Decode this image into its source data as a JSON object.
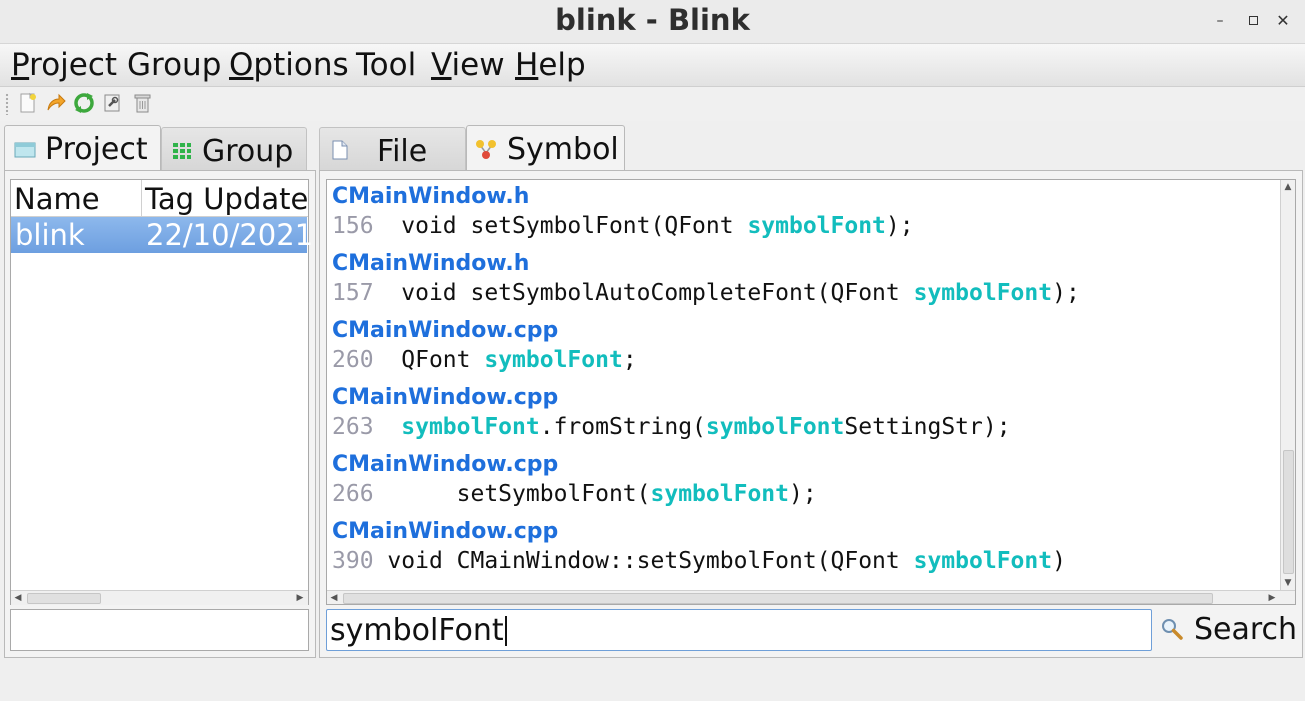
{
  "window": {
    "title": "blink - Blink"
  },
  "menu": [
    {
      "label": "Project",
      "underline": "P"
    },
    {
      "label": "Group",
      "underline": ""
    },
    {
      "label": "Options",
      "underline": "O"
    },
    {
      "label": "Tool",
      "underline": ""
    },
    {
      "label": "View",
      "underline": "V"
    },
    {
      "label": "Help",
      "underline": "H"
    }
  ],
  "toolbar": {
    "icons": [
      "new-project-icon",
      "open-icon",
      "refresh-icon",
      "settings-icon",
      "delete-icon"
    ]
  },
  "left_tabs": [
    {
      "label": "Project",
      "icon": "project-icon"
    },
    {
      "label": "Group",
      "icon": "group-icon"
    }
  ],
  "project_table": {
    "headers": [
      "Name",
      "Tag Update"
    ],
    "rows": [
      {
        "name": "blink",
        "tag_update": "22/10/2021"
      }
    ]
  },
  "right_tabs": [
    {
      "label": "File",
      "icon": "file-icon"
    },
    {
      "label": "Symbol",
      "icon": "symbol-icon"
    }
  ],
  "results": [
    {
      "file": "CMainWindow.h",
      "line": "156",
      "indent": "  ",
      "segments": [
        {
          "t": "void setSymbolFont(QFont ",
          "h": false
        },
        {
          "t": "symbolFont",
          "h": true
        },
        {
          "t": ");",
          "h": false
        }
      ]
    },
    {
      "file": "CMainWindow.h",
      "line": "157",
      "indent": "  ",
      "segments": [
        {
          "t": "void setSymbolAutoCompleteFont(QFont ",
          "h": false
        },
        {
          "t": "symbolFont",
          "h": true
        },
        {
          "t": ");",
          "h": false
        }
      ]
    },
    {
      "file": "CMainWindow.cpp",
      "line": "260",
      "indent": "  ",
      "segments": [
        {
          "t": "QFont ",
          "h": false
        },
        {
          "t": "symbolFont",
          "h": true
        },
        {
          "t": ";",
          "h": false
        }
      ]
    },
    {
      "file": "CMainWindow.cpp",
      "line": "263",
      "indent": "  ",
      "segments": [
        {
          "t": "symbolFont",
          "h": true
        },
        {
          "t": ".fromString(",
          "h": false
        },
        {
          "t": "symbolFont",
          "h": true
        },
        {
          "t": "SettingStr);",
          "h": false
        }
      ]
    },
    {
      "file": "CMainWindow.cpp",
      "line": "266",
      "indent": "      ",
      "segments": [
        {
          "t": "setSymbolFont(",
          "h": false
        },
        {
          "t": "symbolFont",
          "h": true
        },
        {
          "t": ");",
          "h": false
        }
      ]
    },
    {
      "file": "CMainWindow.cpp",
      "line": "390",
      "indent": " ",
      "segments": [
        {
          "t": "void CMainWindow::setSymbolFont(QFont ",
          "h": false
        },
        {
          "t": "symbolFont",
          "h": true
        },
        {
          "t": ")",
          "h": false
        }
      ]
    }
  ],
  "group_filter": {
    "value": ""
  },
  "search": {
    "value": "symbolFont",
    "button_label": "Search"
  },
  "colors": {
    "selection": "#7aa9e6",
    "file_link": "#1e6fdc",
    "highlight": "#12bdbd",
    "line_number": "#9a9aa8"
  }
}
